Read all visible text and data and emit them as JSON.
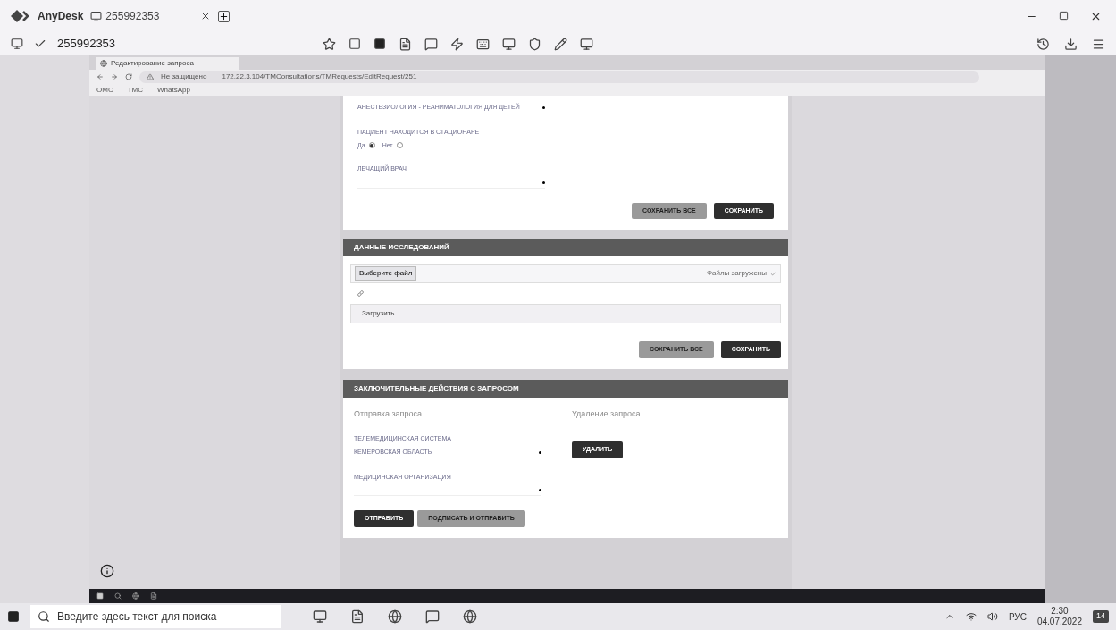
{
  "anydesk": {
    "app_name": "AnyDesk",
    "tab": {
      "label": "255992353"
    },
    "address": "255992353"
  },
  "browser": {
    "tab_title": "Редактирование запроса",
    "url_warning": "Не защищено",
    "url": "172.22.3.104/TMConsultations/TMRequests/EditRequest/251",
    "bookmarks": [
      "ОМС",
      "ТМС",
      "WhatsApp"
    ]
  },
  "section_top": {
    "fields": [
      {
        "kind": "select",
        "value": "АНЕСТЕЗИОЛОГИЯ - РЕАНИМАТОЛОГИЯ ДЛЯ ДЕТЕЙ"
      },
      {
        "kind": "radio",
        "label": "ПАЦИЕНТ НАХОДИТСЯ В СТАЦИОНАРЕ",
        "options": [
          {
            "label": "Да",
            "selected": true
          },
          {
            "label": "Нет",
            "selected": false
          }
        ]
      },
      {
        "kind": "select",
        "label": "ЛЕЧАЩИЙ ВРАЧ"
      }
    ],
    "buttons": [
      {
        "label": "СОХРАНИТЬ ВСЕ",
        "kind": "secondary"
      },
      {
        "label": "СОХРАНИТЬ",
        "kind": "primary"
      }
    ]
  },
  "section_research": {
    "title": "ДАННЫЕ ИССЛЕДОВАНИЙ",
    "file_button": "Выберите файл",
    "status": "Файлы загружены",
    "upload_button": "Загрузить",
    "buttons": [
      {
        "label": "СОХРАНИТЬ ВСЕ",
        "kind": "secondary"
      },
      {
        "label": "СОХРАНИТЬ",
        "kind": "primary"
      }
    ]
  },
  "section_final": {
    "title": "ЗАКЛЮЧИТЕЛЬНЫЕ ДЕЙСТВИЯ С ЗАПРОСОМ",
    "send": {
      "heading": "Отправка запроса",
      "fields": [
        {
          "label": "ТЕЛЕМЕДИЦИНСКАЯ СИСТЕМА",
          "value": "КЕМЕРОВСКАЯ ОБЛАСТЬ"
        },
        {
          "label": "МЕДИЦИНСКАЯ ОРГАНИЗАЦИЯ"
        }
      ],
      "buttons": [
        {
          "label": "ОТПРАВИТЬ",
          "kind": "primary"
        },
        {
          "label": "ПОДПИСАТЬ И ОТПРАВИТЬ",
          "kind": "secondary"
        }
      ]
    },
    "delete": {
      "heading": "Удаление запроса",
      "button": {
        "label": "УДАЛИТЬ",
        "kind": "primary"
      }
    }
  },
  "taskbar": {
    "search_placeholder": "Введите здесь текст для поиска",
    "language": "РУС",
    "time": "2:30",
    "date": "04.07.2022",
    "notifications": "14"
  }
}
